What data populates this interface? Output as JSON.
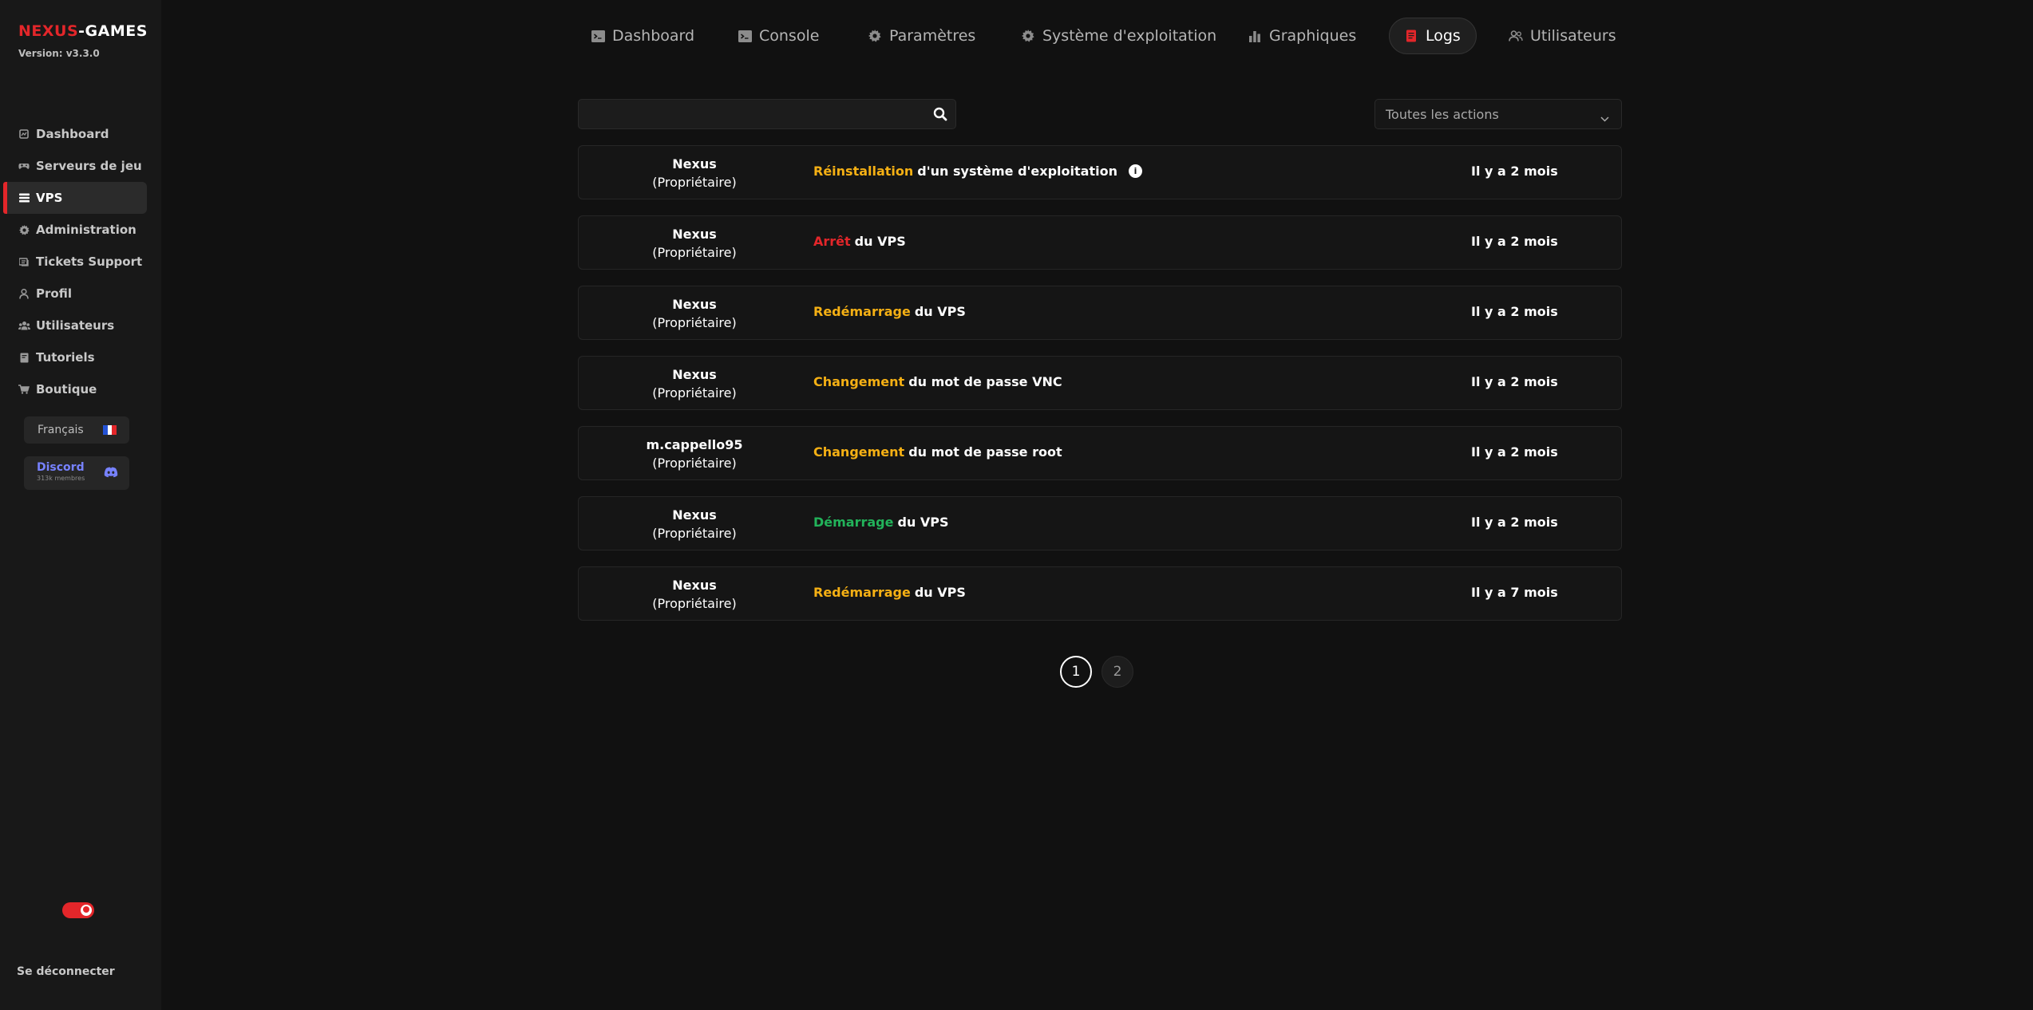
{
  "sidebar": {
    "brand_part1": "NEXUS",
    "brand_part2": "-GAMES",
    "version": "Version: v3.3.0",
    "items": [
      {
        "label": "Dashboard",
        "icon": "dashboard-icon",
        "active": false
      },
      {
        "label": "Serveurs de jeu",
        "icon": "gamepad-icon",
        "active": false
      },
      {
        "label": "VPS",
        "icon": "server-list-icon",
        "active": true
      },
      {
        "label": "Administration",
        "icon": "gear-icon",
        "active": false
      },
      {
        "label": "Tickets Support",
        "icon": "ticket-icon",
        "active": false
      },
      {
        "label": "Profil",
        "icon": "user-icon",
        "active": false
      },
      {
        "label": "Utilisateurs",
        "icon": "users-icon",
        "active": false
      },
      {
        "label": "Tutoriels",
        "icon": "book-icon",
        "active": false
      },
      {
        "label": "Boutique",
        "icon": "cart-icon",
        "active": false
      }
    ],
    "language": "Français",
    "discord": {
      "label": "Discord",
      "members": "313k membres"
    },
    "logout": "Se déconnecter",
    "theme_toggle_on": true
  },
  "tabs": [
    {
      "label": "Dashboard",
      "icon": "terminal-icon"
    },
    {
      "label": "Console",
      "icon": "terminal-icon"
    },
    {
      "label": "Paramètres",
      "icon": "gear-icon"
    },
    {
      "label": "Système d'exploitation",
      "icon": "gear-icon"
    },
    {
      "label": "Graphiques",
      "icon": "bar-chart-icon"
    },
    {
      "label": "Logs",
      "icon": "log-icon",
      "active": true
    },
    {
      "label": "Utilisateurs",
      "icon": "users-icon"
    }
  ],
  "search": {
    "value": "",
    "placeholder": ""
  },
  "filter": {
    "selected": "Toutes les actions"
  },
  "logs": [
    {
      "user": "Nexus",
      "role": "(Propriétaire)",
      "verb": "Réinstallation",
      "verb_color": "#f5b014",
      "rest": "d'un système d'exploitation",
      "info": true,
      "time": "Il y a 2 mois"
    },
    {
      "user": "Nexus",
      "role": "(Propriétaire)",
      "verb": "Arrêt",
      "verb_color": "#e3262a",
      "rest": "du VPS",
      "info": false,
      "time": "Il y a 2 mois"
    },
    {
      "user": "Nexus",
      "role": "(Propriétaire)",
      "verb": "Redémarrage",
      "verb_color": "#f5b014",
      "rest": "du VPS",
      "info": false,
      "time": "Il y a 2 mois"
    },
    {
      "user": "Nexus",
      "role": "(Propriétaire)",
      "verb": "Changement",
      "verb_color": "#f5b014",
      "rest": "du mot de passe VNC",
      "info": false,
      "time": "Il y a 2 mois"
    },
    {
      "user": "m.cappello95",
      "role": "(Propriétaire)",
      "verb": "Changement",
      "verb_color": "#f5b014",
      "rest": "du mot de passe root",
      "info": false,
      "time": "Il y a 2 mois"
    },
    {
      "user": "Nexus",
      "role": "(Propriétaire)",
      "verb": "Démarrage",
      "verb_color": "#22b35a",
      "rest": "du VPS",
      "info": false,
      "time": "Il y a 2 mois"
    },
    {
      "user": "Nexus",
      "role": "(Propriétaire)",
      "verb": "Redémarrage",
      "verb_color": "#f5b014",
      "rest": "du VPS",
      "info": false,
      "time": "Il y a 7 mois"
    }
  ],
  "pagination": {
    "pages": [
      "1",
      "2"
    ],
    "current": "1"
  },
  "colors": {
    "accent": "#e3262a",
    "warning": "#f5b014",
    "success": "#22b35a",
    "discord": "#7782ff"
  }
}
